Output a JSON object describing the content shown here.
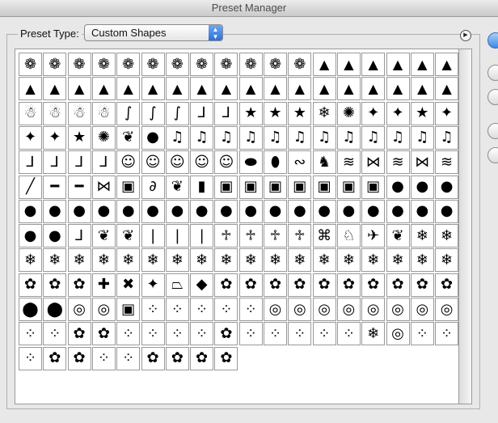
{
  "window": {
    "title": "Preset Manager"
  },
  "preset": {
    "label": "Preset Type:",
    "value": "Custom Shapes"
  },
  "options_icon": "options-arrow-icon",
  "colors": {
    "accent": "#3d8ae6",
    "background": "#e8e8e8",
    "swatch_border": "#999999"
  },
  "grid": {
    "columns": 18,
    "shapes": [
      "wreath",
      "wreath",
      "wreath",
      "wreath",
      "wreath",
      "wreath",
      "wreath",
      "wreath",
      "wreath",
      "wreath",
      "wreath",
      "wreath",
      "tree",
      "tree",
      "tree",
      "tree",
      "tree",
      "tree",
      "tree",
      "tree",
      "tree",
      "tree",
      "tree",
      "tree",
      "tree",
      "tree",
      "tree",
      "tree",
      "tree",
      "tree",
      "tree",
      "tree",
      "tree",
      "tree",
      "tree",
      "tree",
      "snowman",
      "snowman",
      "snowman",
      "snowman",
      "stocking",
      "stocking",
      "stocking",
      "candy-cane",
      "candy-cane",
      "star",
      "star",
      "star",
      "snowflake",
      "star-burst",
      "sparkle",
      "sparkle",
      "star",
      "sparkle",
      "sparkle",
      "sparkle",
      "star",
      "star-burst",
      "holly",
      "ornament",
      "bell",
      "bell",
      "bell",
      "bell",
      "bell",
      "bell",
      "bell",
      "bell",
      "bell",
      "bell",
      "bell",
      "bell",
      "candy-cane",
      "candy-cane",
      "candy-cane",
      "candy-cane",
      "santa",
      "santa",
      "santa",
      "santa",
      "santa",
      "sleigh",
      "bulb",
      "lights",
      "rocking-horse",
      "garland",
      "bow",
      "garland",
      "bow",
      "garland",
      "stroke",
      "ribbon",
      "ribbon",
      "bow",
      "gift",
      "curl",
      "holly",
      "box",
      "gift",
      "gift",
      "gift",
      "gift",
      "gift",
      "gift",
      "gift",
      "ornament",
      "ornament",
      "ornament",
      "ornament",
      "ornament",
      "ornament",
      "ornament",
      "ornament",
      "ornament",
      "ornament",
      "ornament",
      "ornament",
      "ornament",
      "ornament",
      "ornament",
      "ornament",
      "ornament",
      "ornament",
      "ornament",
      "ornament",
      "ornament",
      "ornament",
      "ornament",
      "candy-cane",
      "holly",
      "holly",
      "candle",
      "candle",
      "candle",
      "angel",
      "angel",
      "angel",
      "angel",
      "candy",
      "reindeer",
      "dove",
      "holly",
      "snowflake",
      "snowflake",
      "snowflake",
      "snowflake",
      "snowflake",
      "snowflake",
      "snowflake",
      "snowflake",
      "snowflake",
      "snowflake",
      "snowflake",
      "snowflake",
      "snowflake",
      "snowflake",
      "snowflake",
      "snowflake",
      "snowflake",
      "snowflake",
      "snowflake",
      "snowflake",
      "flower",
      "flower",
      "flower",
      "cross",
      "x-shape",
      "sparkle",
      "trapezoid",
      "diamond",
      "flower",
      "flower",
      "flower",
      "flower",
      "flower",
      "flower",
      "flower",
      "flower",
      "flower",
      "flower",
      "circle",
      "circle",
      "ring",
      "ring",
      "square-ring",
      "dot-ring",
      "dot-ring",
      "dot-ring",
      "dot-ring",
      "dot-ring",
      "ring",
      "ring",
      "ring",
      "ring",
      "ring",
      "ring",
      "ring",
      "ring",
      "dot-ring",
      "dot-ring",
      "flower",
      "flower",
      "dot-ring",
      "dot-ring",
      "dot-ring",
      "dot-ring",
      "flower",
      "dot-ring",
      "dot-ring",
      "dot-ring",
      "dot-ring",
      "dot-ring",
      "snowflake",
      "ring",
      "dot-ring",
      "dot-ring",
      "dot-ring",
      "flower",
      "flower",
      "dot-ring",
      "dot-ring",
      "flower",
      "flower",
      "flower",
      "flower"
    ]
  },
  "side_buttons": [
    {
      "kind": "primary"
    },
    {
      "kind": "normal"
    },
    {
      "kind": "normal"
    },
    {
      "kind": "normal"
    },
    {
      "kind": "normal"
    }
  ]
}
